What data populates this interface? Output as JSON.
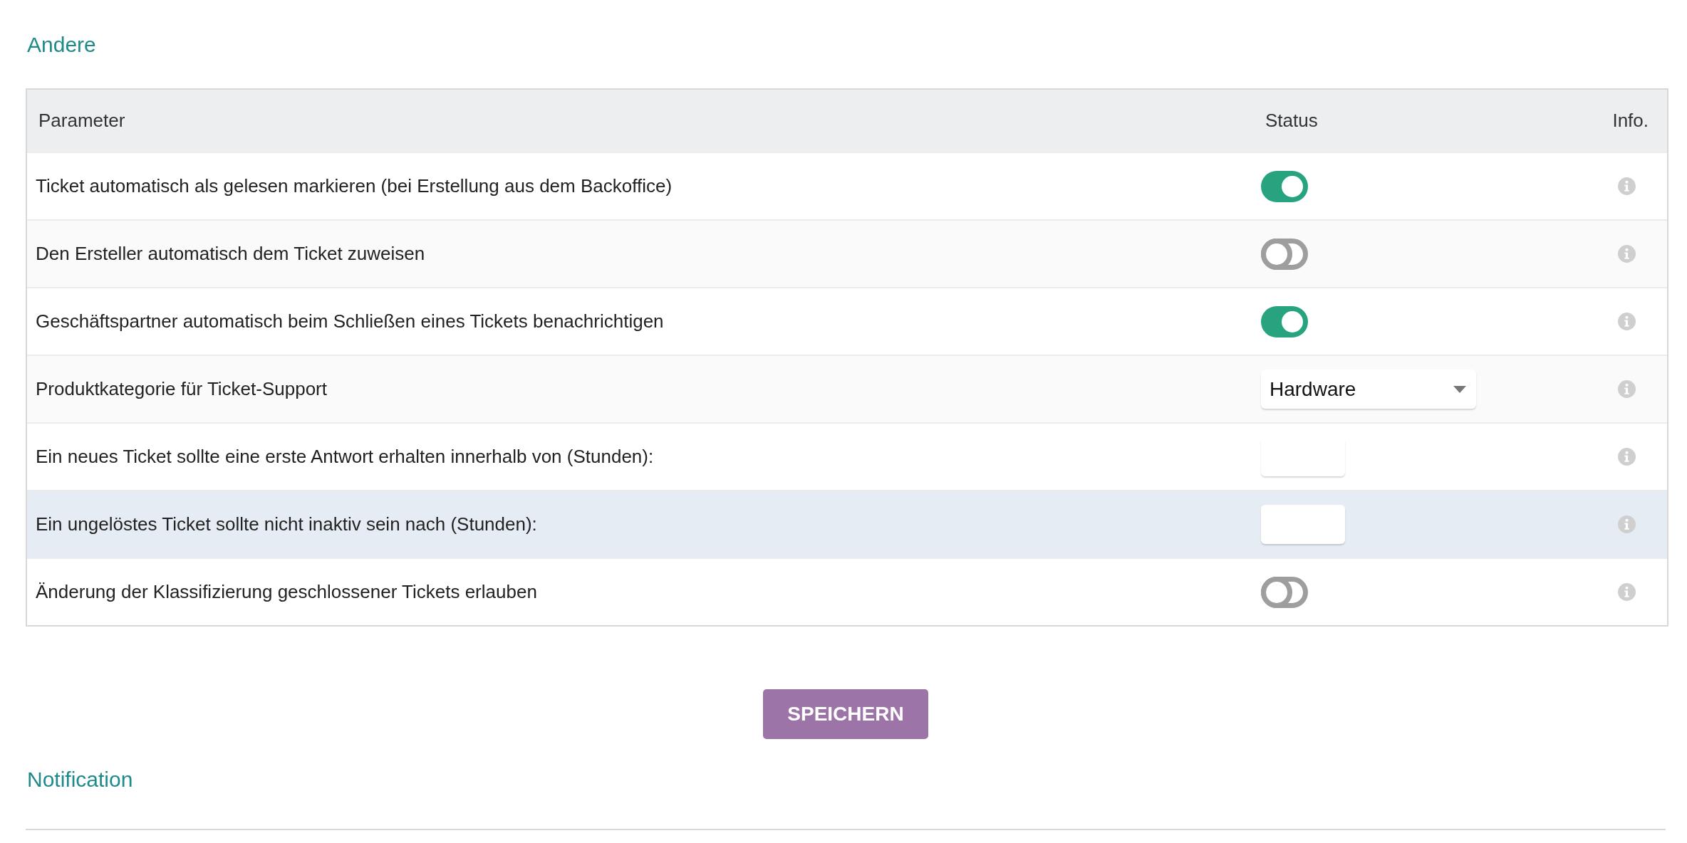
{
  "sections": [
    {
      "title": "Andere",
      "table": {
        "columns": [
          "Parameter",
          "Status",
          "Info."
        ],
        "rows": [
          {
            "label": "Ticket automatisch als gelesen markieren (bei Erstellung aus dem Backoffice)",
            "kind": "toggle",
            "on": true,
            "highlighted": false
          },
          {
            "label": "Den Ersteller automatisch dem Ticket zuweisen",
            "kind": "toggle",
            "on": false,
            "highlighted": false
          },
          {
            "label": "Geschäftspartner automatisch beim Schließen eines Tickets benachrichtigen",
            "kind": "toggle",
            "on": true,
            "highlighted": false
          },
          {
            "label": "Produktkategorie für Ticket-Support",
            "kind": "select",
            "value": "Hardware",
            "highlighted": false
          },
          {
            "label": "Ein neues Ticket sollte eine erste Antwort erhalten innerhalb von (Stunden):",
            "kind": "number",
            "highlighted": false
          },
          {
            "label": "Ein ungelöstes Ticket sollte nicht inaktiv sein nach (Stunden):",
            "kind": "number",
            "highlighted": true
          },
          {
            "label": "Änderung der Klassifizierung geschlossener Tickets erlauben",
            "kind": "toggle",
            "on": false,
            "highlighted": false
          }
        ]
      },
      "button": "SPEICHERN"
    },
    {
      "title": "Notification"
    }
  ]
}
